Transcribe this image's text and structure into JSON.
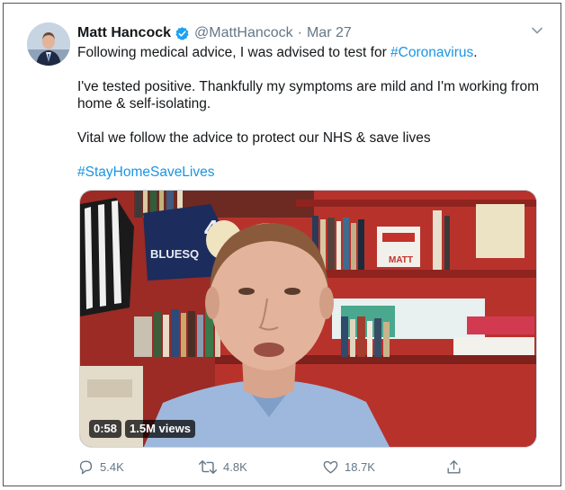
{
  "tweet": {
    "display_name": "Matt Hancock",
    "handle": "@MattHancock",
    "separator": "·",
    "date": "Mar 27",
    "line1_prefix": "Following medical advice, I was advised to test for ",
    "line1_hashtag": "#Coronavirus",
    "line1_suffix": ".",
    "para2": "I've tested positive. Thankfully my symptoms are mild and I'm working from home & self-isolating.",
    "para3": "Vital we follow the advice to protect our NHS & save lives",
    "hashtag2": "#StayHomeSaveLives"
  },
  "video": {
    "duration": "0:58",
    "views": "1.5M views",
    "jersey_text": "BLUESQ",
    "jersey_number": "4",
    "box_text": "MATT"
  },
  "actions": {
    "replies": "5.4K",
    "retweets": "4.8K",
    "likes": "18.7K"
  },
  "colors": {
    "link": "#1b95e0",
    "verified": "#1da1f2",
    "meta": "#657786",
    "shelf_red": "#b8322c"
  },
  "icons": [
    "verified-badge-icon",
    "chevron-down-icon",
    "reply-icon",
    "retweet-icon",
    "like-icon",
    "share-icon"
  ]
}
